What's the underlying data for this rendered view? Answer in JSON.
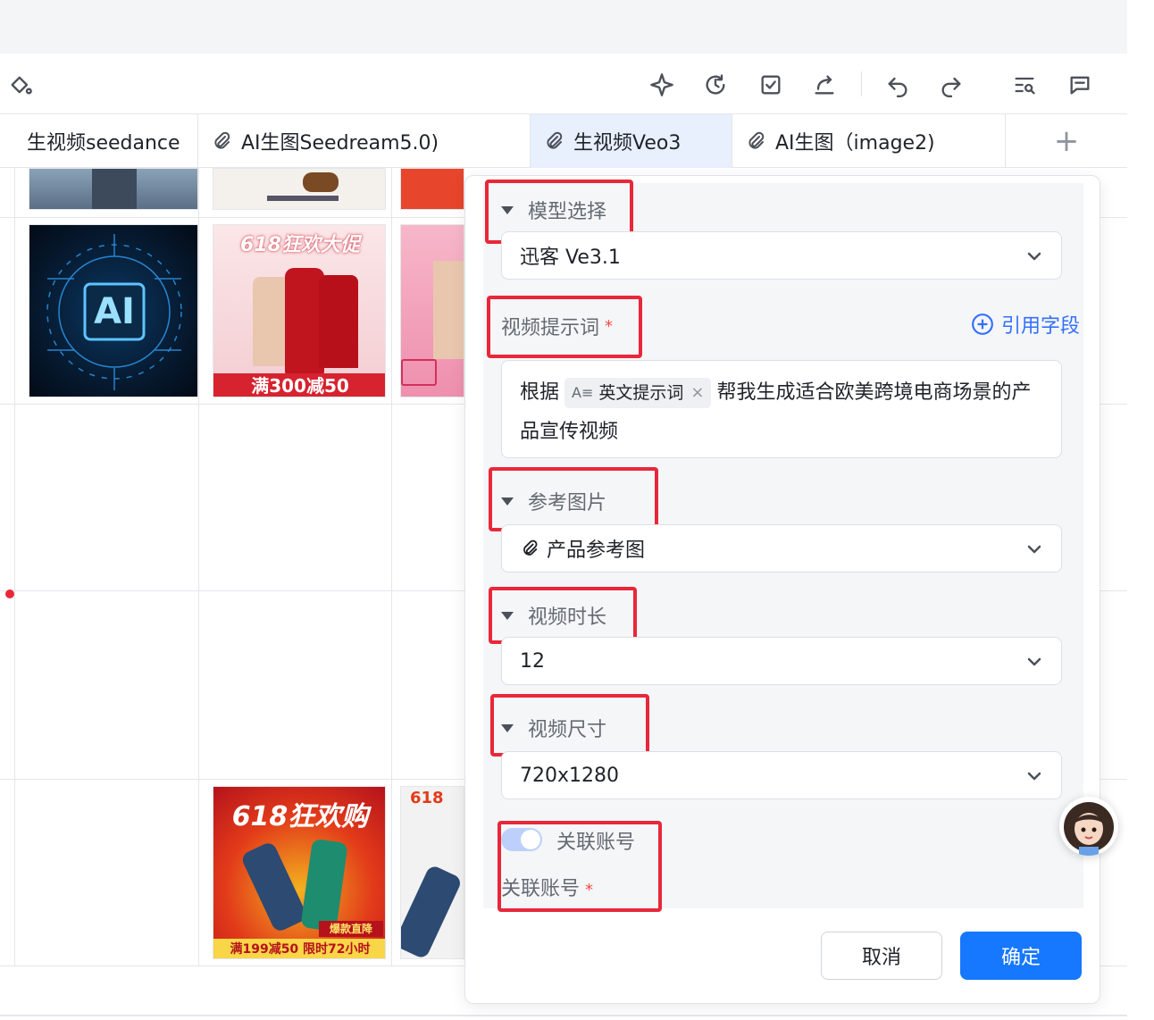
{
  "toolbar": {
    "icons": [
      "paint-bucket-icon",
      "sparkle-icon",
      "history-icon",
      "checklist-icon",
      "share-icon",
      "undo-icon",
      "redo-icon",
      "search-list-icon",
      "comment-icon"
    ]
  },
  "columns": [
    {
      "label": "生视频seedance",
      "has_attachment_icon": false
    },
    {
      "label": "AI生图Seedream5.0)",
      "has_attachment_icon": true
    },
    {
      "label": "生视频Veo3",
      "has_attachment_icon": true,
      "active": true
    },
    {
      "label": "AI生图（image2)",
      "has_attachment_icon": true
    }
  ],
  "add_column_label": "+",
  "thumbnails": {
    "ai_chip_text": "AI",
    "banner_618_a": "618狂欢大促",
    "banner_618_a_price": "满300减50",
    "banner_618_b": "618狂欢购",
    "banner_618_b_badge": "爆款直降",
    "banner_618_b_price": "满199减50 限时72小时",
    "banner_618_c": "618"
  },
  "panel": {
    "model_section_title": "模型选择",
    "model_value": "迅客 Ve3.1",
    "prompt_section_title": "视频提示词",
    "required_mark": "*",
    "cite_label": "引用字段",
    "prompt_text_before": "根据",
    "prompt_chip_icon": "A≡",
    "prompt_chip_label": "英文提示词",
    "prompt_chip_close": "×",
    "prompt_text_after": "帮我生成适合欧美跨境电商场景的产品宣传视频",
    "ref_section_title": "参考图片",
    "ref_value": "产品参考图",
    "duration_section_title": "视频时长",
    "duration_value": "12",
    "size_section_title": "视频尺寸",
    "size_value": "720x1280",
    "toggle_label": "关联账号",
    "assoc_label": "关联账号",
    "cancel_label": "取消",
    "ok_label": "确定"
  },
  "colors": {
    "primary": "#1677ff",
    "link": "#3370ff",
    "highlight_box": "#e8283a",
    "active_column_bg": "#e8effd"
  }
}
